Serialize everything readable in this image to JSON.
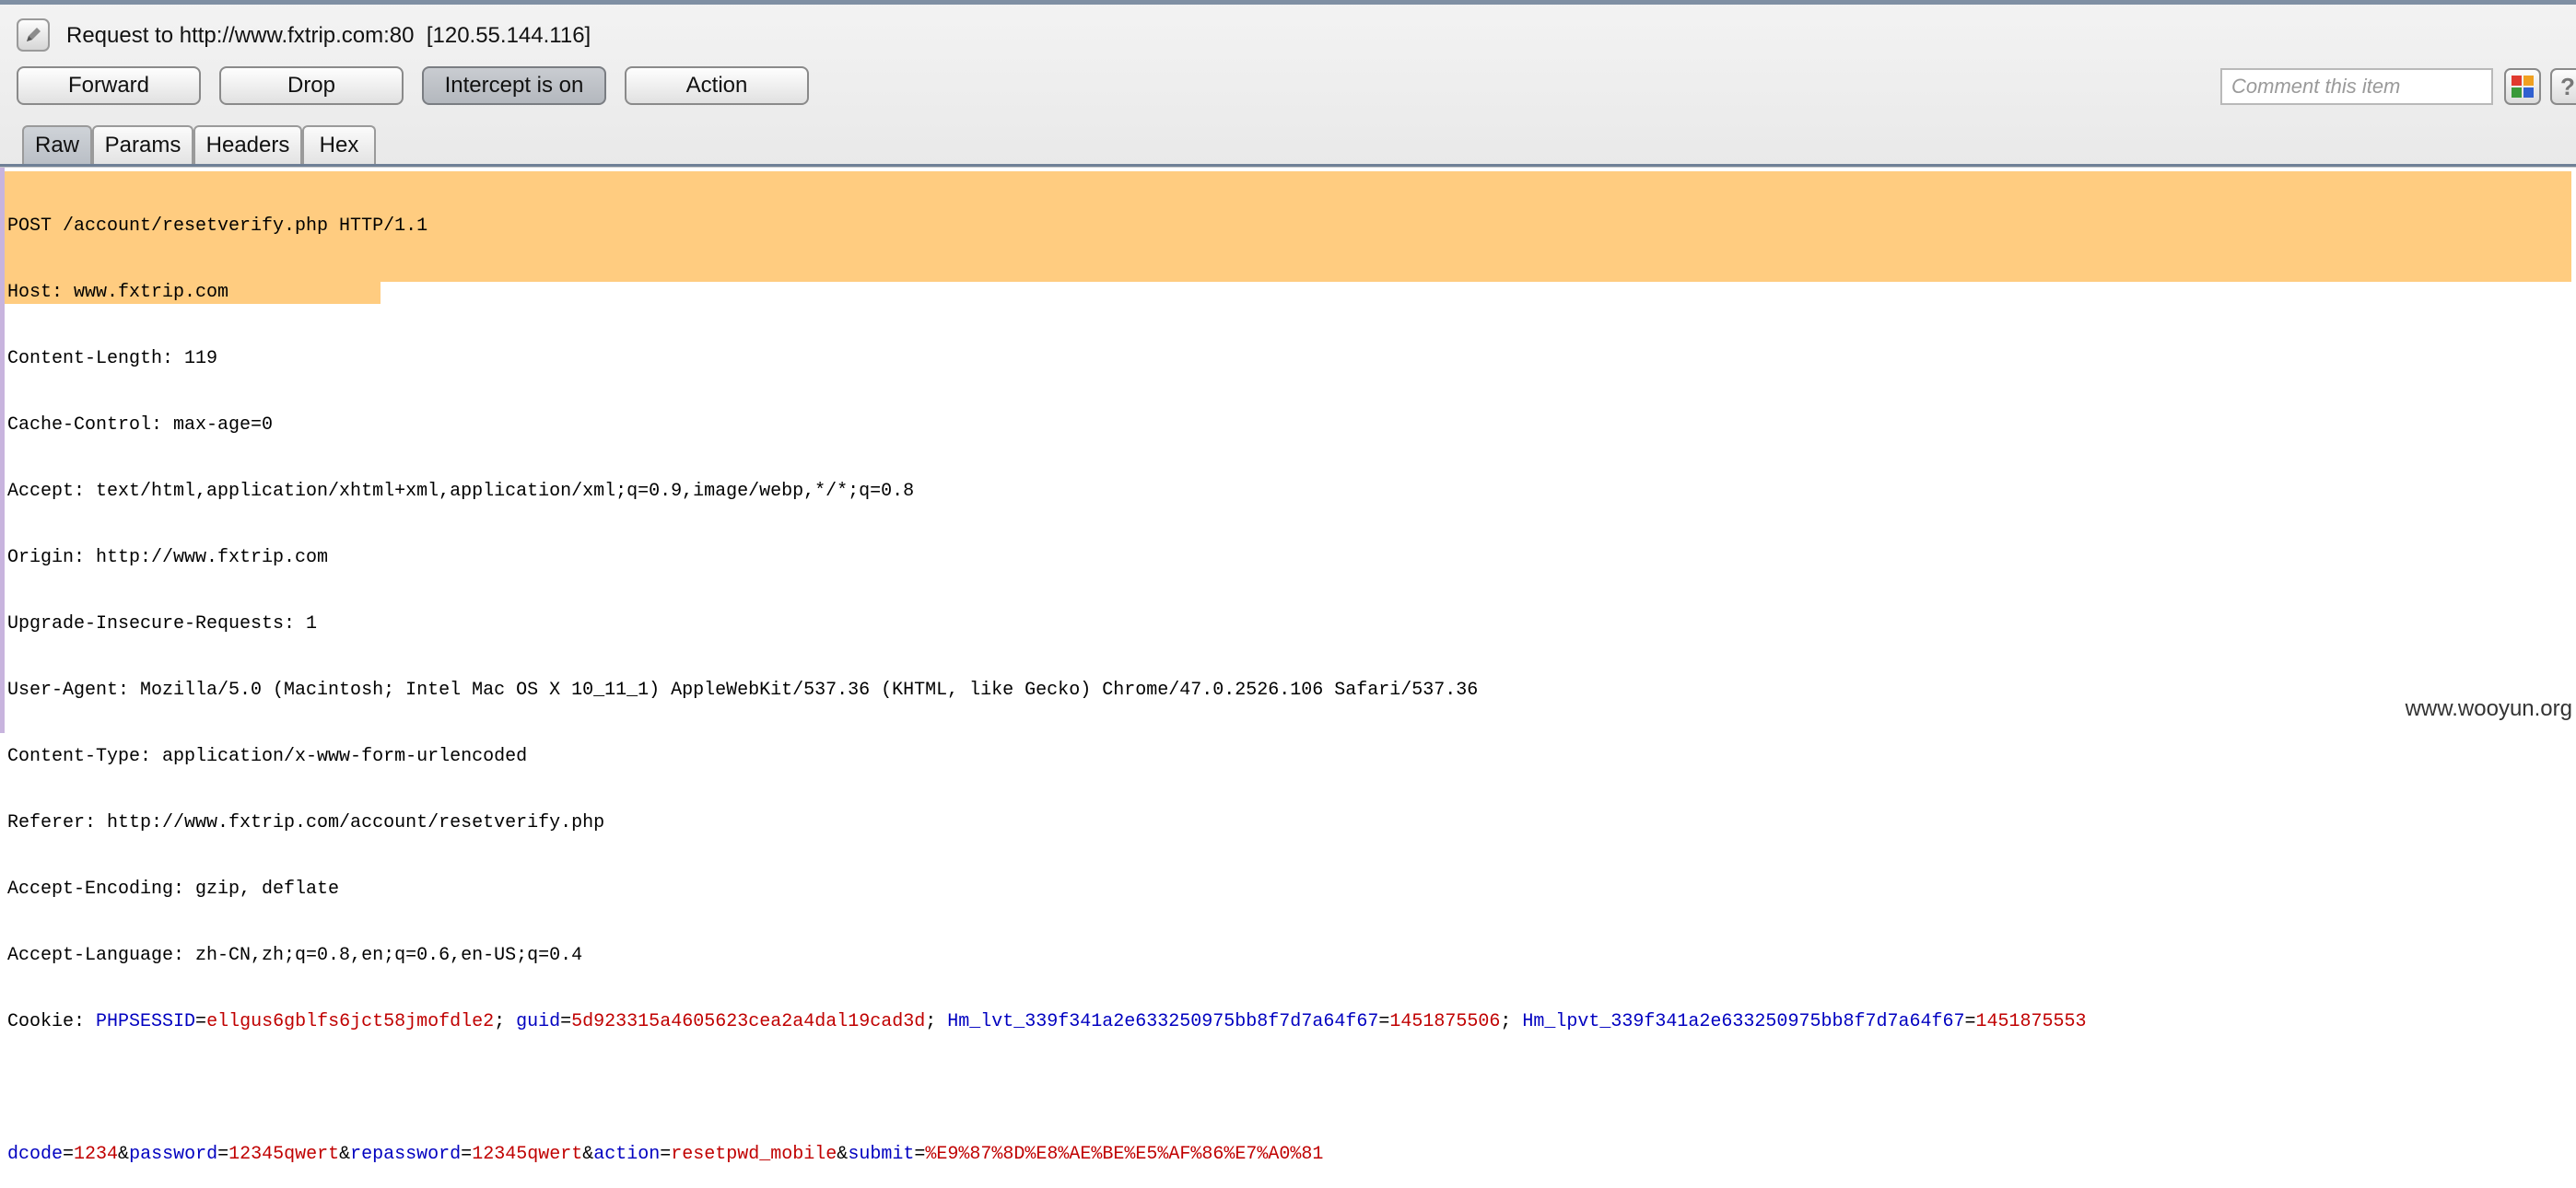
{
  "request": {
    "title": "Request to http://www.fxtrip.com:80  [120.55.144.116]"
  },
  "toolbar": {
    "forward_label": "Forward",
    "drop_label": "Drop",
    "intercept_label": "Intercept is on",
    "action_label": "Action",
    "comment_placeholder": "Comment this item",
    "color_icon": "color-grid-icon",
    "help_icon": "help-icon"
  },
  "tabs": {
    "raw": "Raw",
    "params": "Params",
    "headers": "Headers",
    "hex": "Hex",
    "active": "Raw"
  },
  "editor": {
    "highlight_color": "#ffcc80",
    "key_color": "#0000c0",
    "value_color": "#c00000",
    "header_lines": [
      "POST /account/resetverify.php HTTP/1.1",
      "Host: www.fxtrip.com",
      "Content-Length: 119",
      "Cache-Control: max-age=0",
      "Accept: text/html,application/xhtml+xml,application/xml;q=0.9,image/webp,*/*;q=0.8",
      "Origin: http://www.fxtrip.com",
      "Upgrade-Insecure-Requests: 1",
      "User-Agent: Mozilla/5.0 (Macintosh; Intel Mac OS X 10_11_1) AppleWebKit/537.36 (KHTML, like Gecko) Chrome/47.0.2526.106 Safari/537.36",
      "Content-Type: application/x-www-form-urlencoded",
      "Referer: http://www.fxtrip.com/account/resetverify.php",
      "Accept-Encoding: gzip, deflate",
      "Accept-Language: zh-CN,zh;q=0.8,en;q=0.6,en-US;q=0.4"
    ],
    "cookie": {
      "label": "Cookie: ",
      "pairs": [
        {
          "key": "PHPSESSID",
          "value": "ellgus6gblfs6jct58jmofdle2",
          "sep": "; "
        },
        {
          "key": "guid",
          "value": "5d923315a4605623cea2a4dal19cad3d",
          "sep": "; "
        },
        {
          "key": "Hm_lvt_339f341a2e633250975bb8f7d7a64f67",
          "value": "1451875506",
          "sep": "; "
        },
        {
          "key": "Hm_lpvt_339f341a2e633250975bb8f7d7a64f67",
          "value": "1451875553",
          "sep": ""
        }
      ]
    },
    "body_params": [
      {
        "key": "dcode",
        "value": "1234",
        "sep": "&"
      },
      {
        "key": "password",
        "value": "12345qwert",
        "sep": "&"
      },
      {
        "key": "repassword",
        "value": "12345qwert",
        "sep": "&"
      },
      {
        "key": "action",
        "value": "resetpwd_mobile",
        "sep": "&"
      },
      {
        "key": "submit",
        "value": "%E9%87%8D%E8%AE%BE%E5%AF%86%E7%A0%81",
        "sep": ""
      }
    ]
  },
  "watermark": "www.wooyun.org"
}
